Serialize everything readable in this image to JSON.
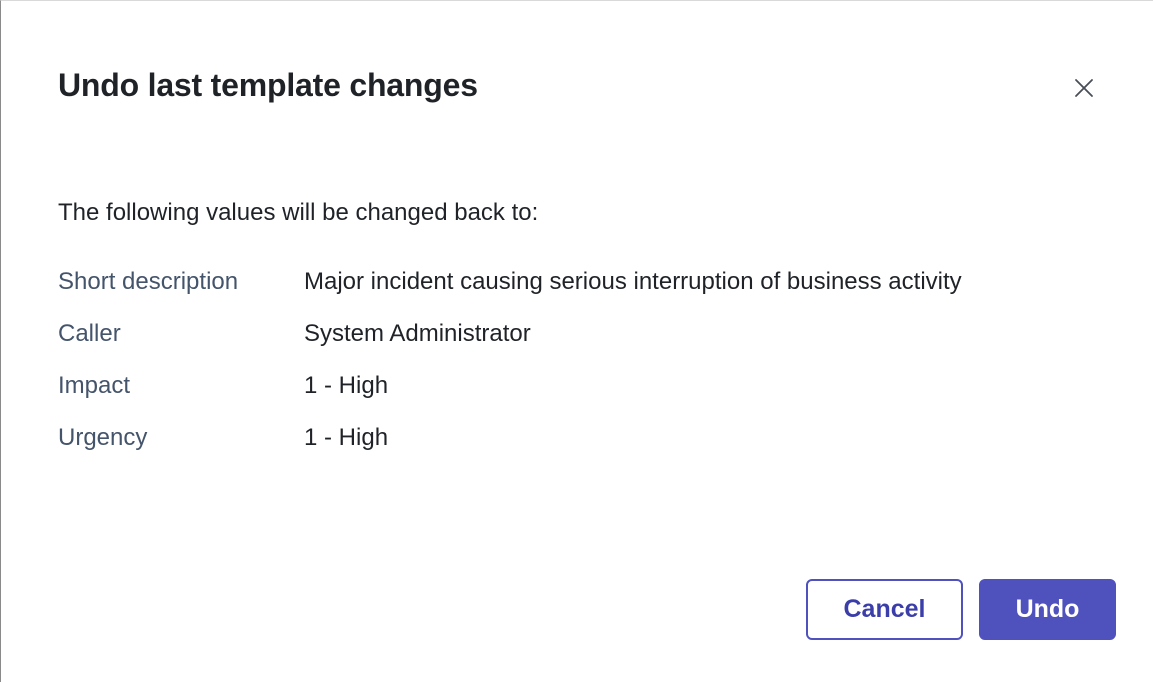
{
  "dialog": {
    "title": "Undo last template changes",
    "intro": "The following values will be changed back to:",
    "fields": [
      {
        "label": "Short description",
        "value": "Major incident causing serious interruption of business activity"
      },
      {
        "label": "Caller",
        "value": "System Administrator"
      },
      {
        "label": "Impact",
        "value": "1 - High"
      },
      {
        "label": "Urgency",
        "value": "1 - High"
      }
    ],
    "buttons": {
      "cancel_label": "Cancel",
      "undo_label": "Undo"
    }
  },
  "icons": {
    "close": "close-icon"
  },
  "colors": {
    "primary": "#4f52bd",
    "label": "#44546b",
    "text": "#1f2328"
  }
}
